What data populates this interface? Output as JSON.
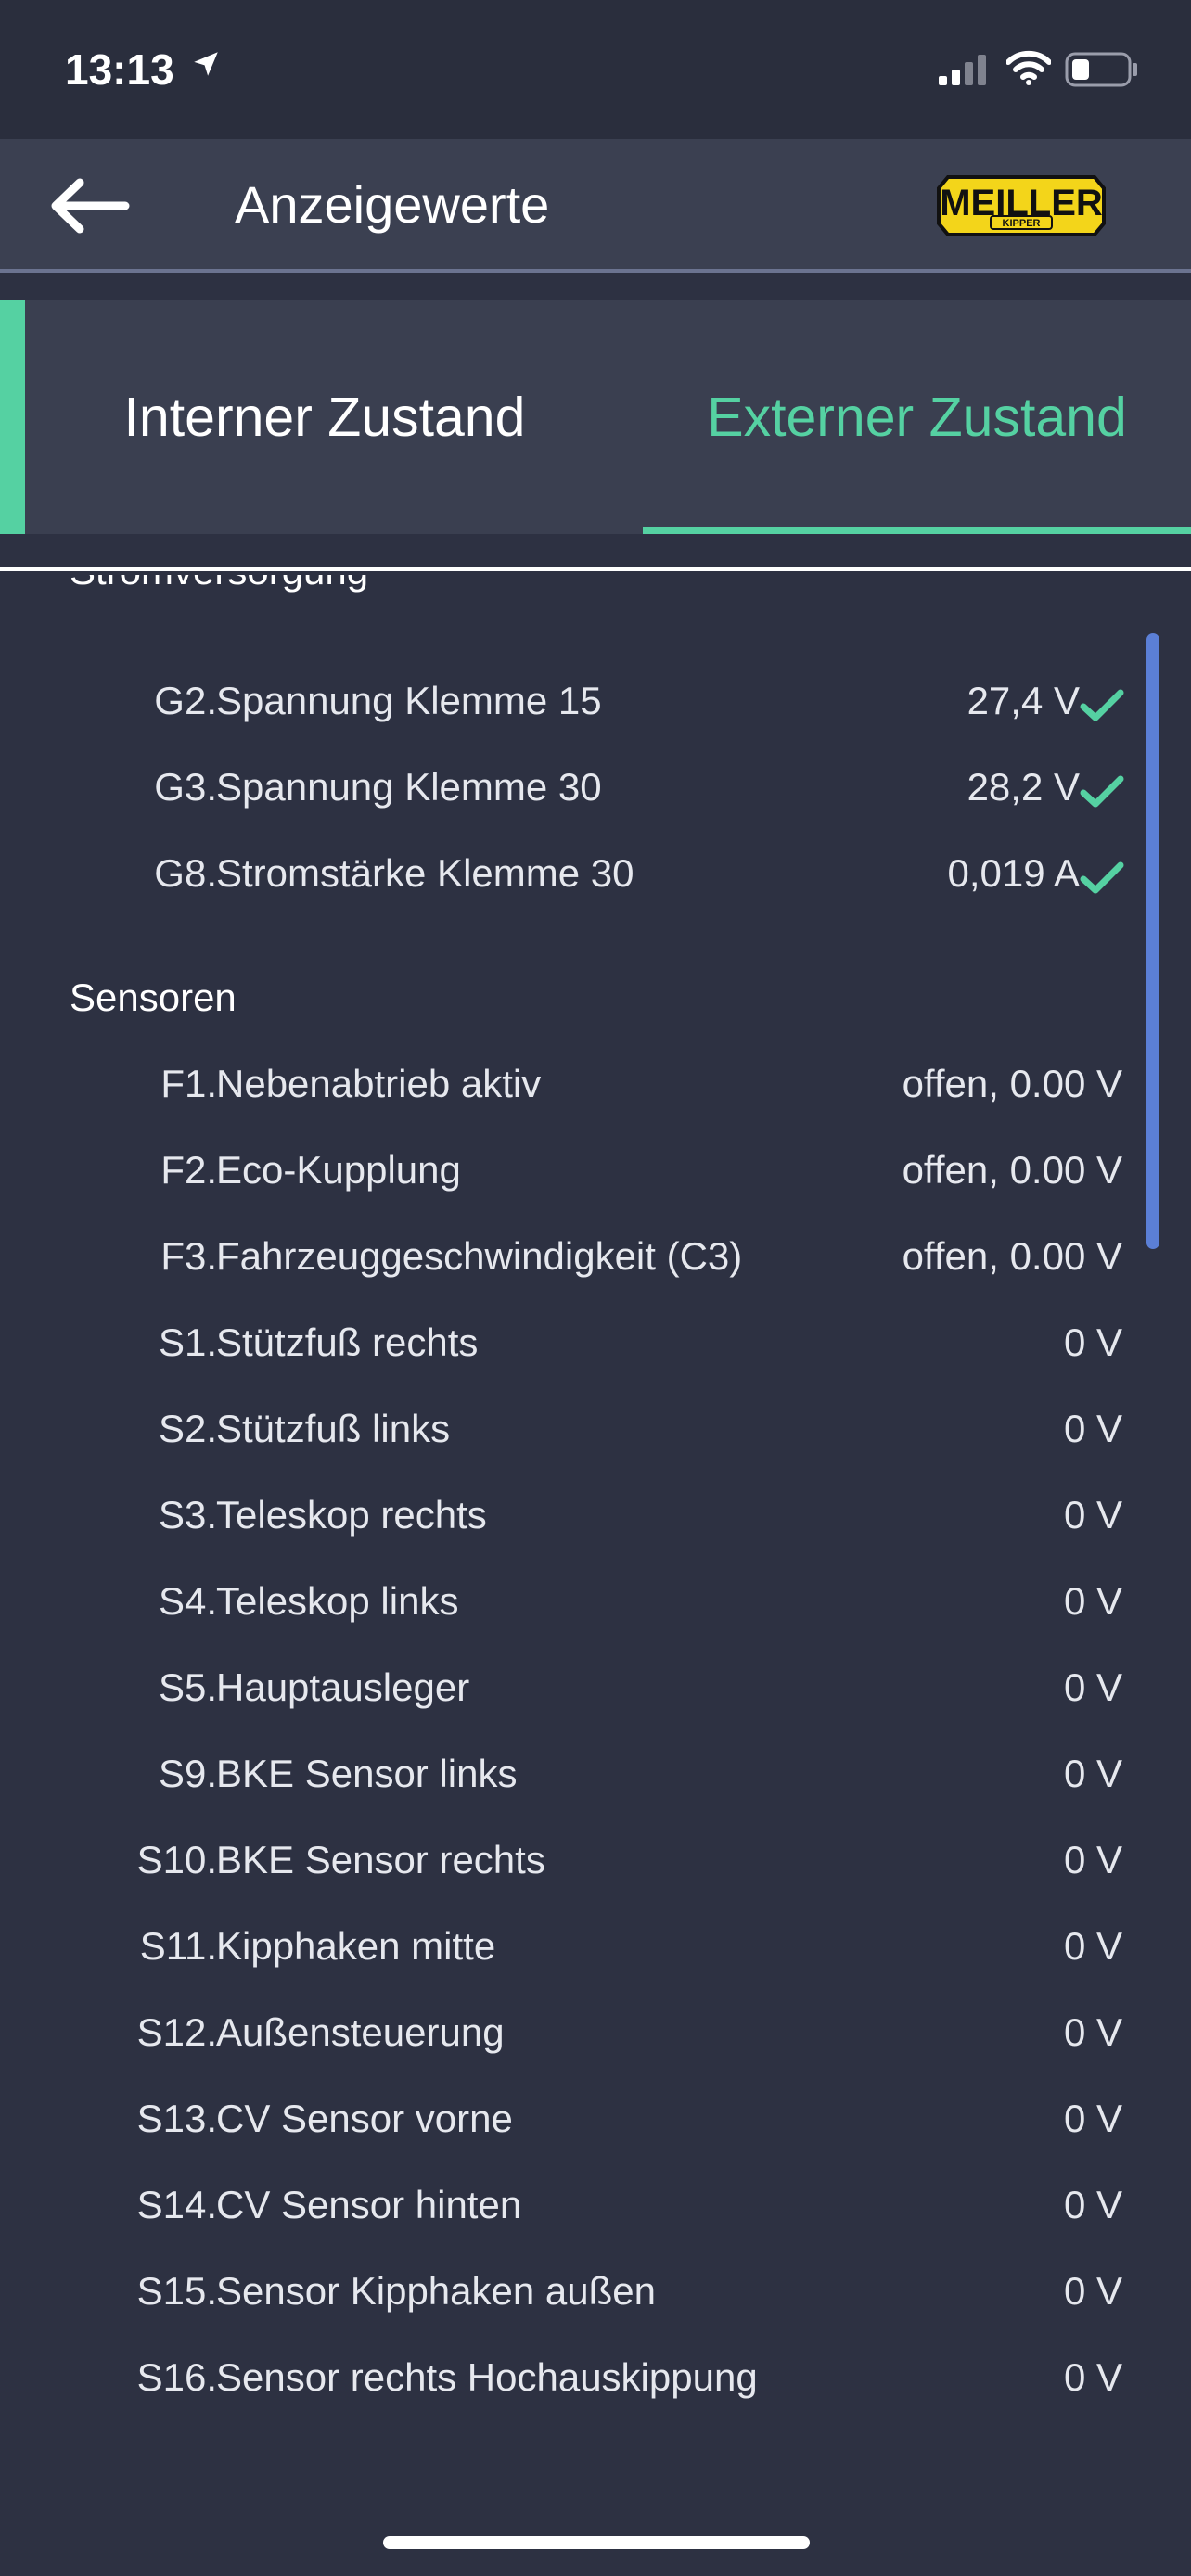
{
  "status": {
    "time": "13:13"
  },
  "header": {
    "title": "Anzeigewerte",
    "logo_text": "MEILLER KIPPER"
  },
  "tabs": [
    {
      "label": "Interner Zustand",
      "active": false
    },
    {
      "label": "Externer Zustand",
      "active": true
    }
  ],
  "colors": {
    "accent": "#55d1a2",
    "background": "#2d3142",
    "scrollbar": "#5b7fd6"
  },
  "sections": [
    {
      "title": "Stromversorgung",
      "items": [
        {
          "code": "G2.",
          "label": "Spannung Klemme 15",
          "value": "27,4 V",
          "status": "check-icon"
        },
        {
          "code": "G3.",
          "label": "Spannung Klemme 30",
          "value": "28,2 V",
          "status": "check-icon"
        },
        {
          "code": "G8.",
          "label": "Stromstärke Klemme 30",
          "value": "0,019 A",
          "status": "check-icon"
        }
      ]
    },
    {
      "title": "Sensoren",
      "items": [
        {
          "code": "F1.",
          "label": "Nebenabtrieb aktiv",
          "value": "offen, 0.00 V"
        },
        {
          "code": "F2.",
          "label": "Eco-Kupplung",
          "value": "offen, 0.00 V"
        },
        {
          "code": "F3.",
          "label": "Fahrzeuggeschwindigkeit (C3)",
          "value": "offen, 0.00 V"
        },
        {
          "code": "S1.",
          "label": "Stützfuß rechts",
          "value": "0 V"
        },
        {
          "code": "S2.",
          "label": "Stützfuß links",
          "value": "0 V"
        },
        {
          "code": "S3.",
          "label": "Teleskop rechts",
          "value": "0 V"
        },
        {
          "code": "S4.",
          "label": "Teleskop links",
          "value": "0 V"
        },
        {
          "code": "S5.",
          "label": "Hauptausleger",
          "value": "0 V"
        },
        {
          "code": "S9.",
          "label": "BKE Sensor links",
          "value": "0 V"
        },
        {
          "code": "S10.",
          "label": "BKE Sensor rechts",
          "value": "0 V"
        },
        {
          "code": "S11.",
          "label": "Kipphaken mitte",
          "value": "0 V"
        },
        {
          "code": "S12.",
          "label": "Außensteuerung",
          "value": "0 V"
        },
        {
          "code": "S13.",
          "label": "CV Sensor vorne",
          "value": "0 V"
        },
        {
          "code": "S14.",
          "label": "CV Sensor hinten",
          "value": "0 V"
        },
        {
          "code": "S15.",
          "label": "Sensor Kipphaken außen",
          "value": "0 V"
        },
        {
          "code": "S16.",
          "label": "Sensor rechts Hochauskippung",
          "value": "0 V"
        }
      ]
    }
  ]
}
